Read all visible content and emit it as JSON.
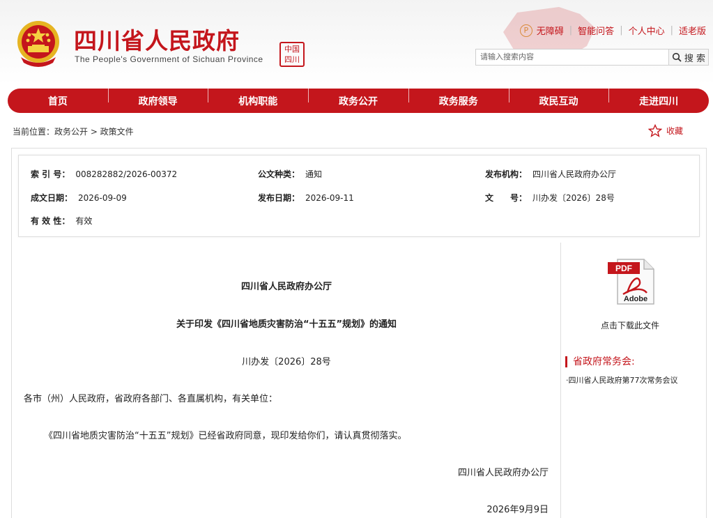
{
  "header": {
    "title": "四川省人民政府",
    "subtitle": "The People's Government of Sichuan Province",
    "seal_text": "中国四川",
    "links": [
      "无障碍",
      "智能问答",
      "个人中心",
      "适老版"
    ],
    "search_placeholder": "请输入搜索内容",
    "search_button": "搜 索"
  },
  "nav": {
    "items": [
      "首页",
      "政府领导",
      "机构职能",
      "政务公开",
      "政务服务",
      "政民互动",
      "走进四川"
    ]
  },
  "breadcrumb": {
    "text": "当前位置：政务公开 > 政策文件"
  },
  "favorite": {
    "label": "收藏"
  },
  "meta": {
    "index_label": "索 引 号：",
    "index_value": "008282882/2026-00372",
    "type_label": "公文种类：",
    "type_value": "通知",
    "issuer_label": "发布机构：",
    "issuer_value": "四川省人民政府办公厅",
    "created_label": "成文日期：",
    "created_value": "2026-09-09",
    "published_label": "发布日期：",
    "published_value": "2026-09-11",
    "docno_label": "文　　号：",
    "docno_value": "川办发〔2026〕28号",
    "validity_label": "有 效 性：",
    "validity_value": "有效"
  },
  "document": {
    "issuer": "四川省人民政府办公厅",
    "title": "关于印发《四川省地质灾害防治“十五五”规划》的通知",
    "docno": "川办发〔2026〕28号",
    "recipients": "各市（州）人民政府，省政府各部门、各直属机构，有关单位：",
    "body": "《四川省地质灾害防治“十五五”规划》已经省政府同意，现印发给你们，请认真贯彻落实。",
    "signature": "四川省人民政府办公厅",
    "date": "2026年9月9日"
  },
  "sidebar": {
    "pdf_text": "PDF",
    "adobe_text": "Adobe",
    "download_label": "点击下载此文件",
    "heading": "省政府常务会:",
    "link": "·四川省人民政府第77次常务会议"
  },
  "colors": {
    "brand_red": "#c4161c"
  }
}
